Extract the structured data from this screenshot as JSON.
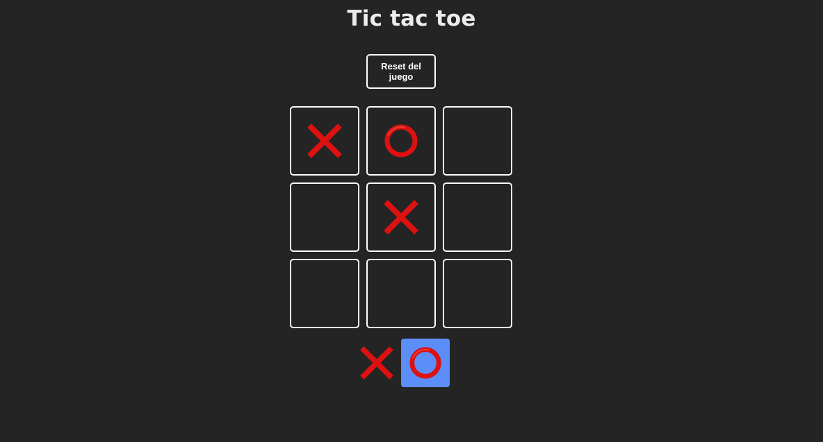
{
  "title": "Tic tac toe",
  "reset_button": {
    "label": "Reset del juego"
  },
  "board": {
    "cells": [
      "X",
      "O",
      "",
      "",
      "X",
      "",
      "",
      "",
      ""
    ]
  },
  "turn_indicator": {
    "players": [
      "X",
      "O"
    ],
    "active": "O",
    "active_color": "#5b8ef8"
  },
  "mark_color": "#dd1111",
  "background_color": "#242424",
  "icons": {
    "X": "cross-mark-icon",
    "O": "circle-mark-icon"
  }
}
